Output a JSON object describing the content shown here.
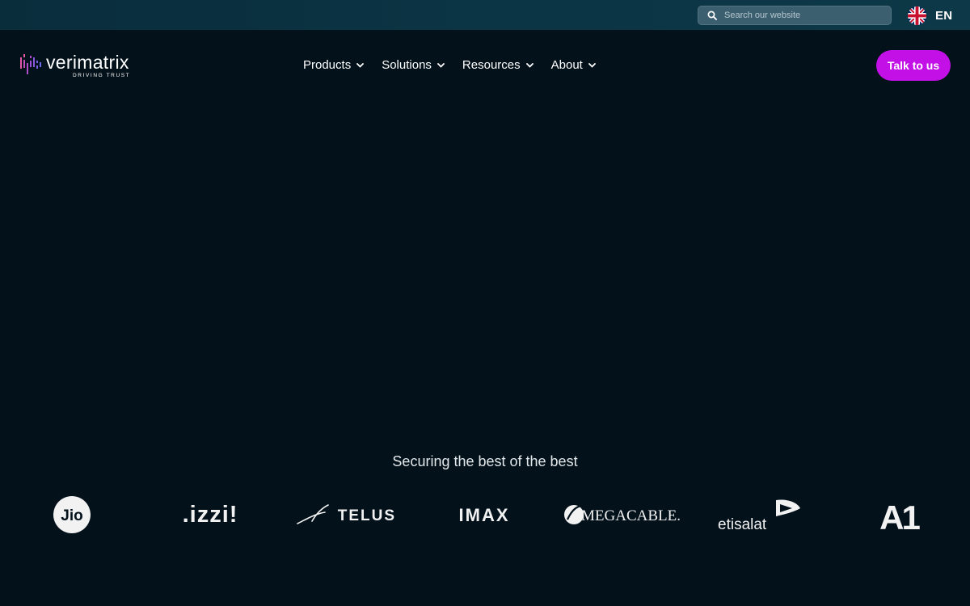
{
  "topbar": {
    "search_placeholder": "Search our website",
    "language_code": "EN"
  },
  "header": {
    "logo_text": "verimatrix",
    "logo_tagline": "DRIVING TRUST",
    "nav": [
      {
        "label": "Products"
      },
      {
        "label": "Solutions"
      },
      {
        "label": "Resources"
      },
      {
        "label": "About"
      }
    ],
    "cta_label": "Talk to us"
  },
  "clients": {
    "heading": "Securing the best of the best",
    "logos": [
      {
        "name": "Jio",
        "text": "Jio"
      },
      {
        "name": "izzi",
        "text": ".izzi!"
      },
      {
        "name": "TELUS",
        "text": "TELUS"
      },
      {
        "name": "IMAX",
        "text": "IMAX"
      },
      {
        "name": "Megacable",
        "text": "MEGACABLE."
      },
      {
        "name": "etisalat",
        "text": "etisalat"
      },
      {
        "name": "A1",
        "text": "A1"
      }
    ]
  },
  "colors": {
    "accent": "#c210e6",
    "background": "#03111b",
    "topbar": "#0b3444"
  },
  "icons": [
    "search-icon",
    "uk-flag-icon",
    "chevron-down-icon",
    "verimatrix-logo-icon"
  ]
}
